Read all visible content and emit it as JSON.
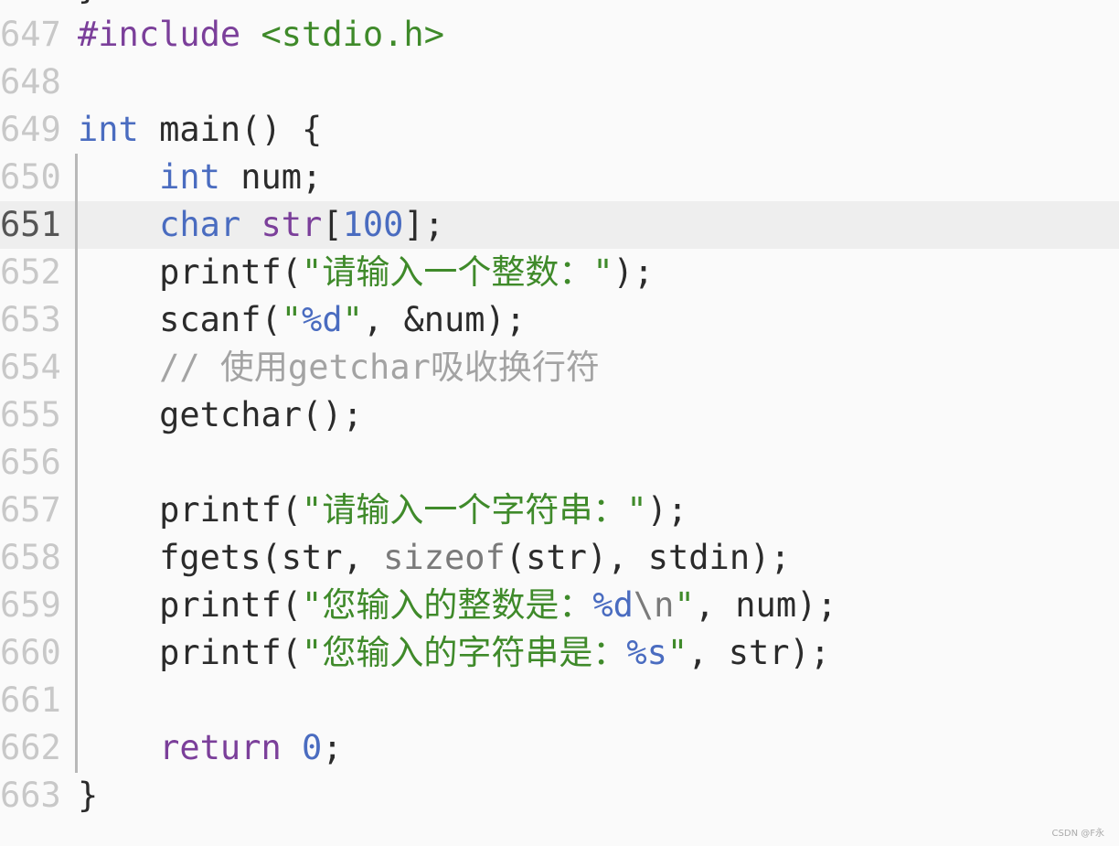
{
  "editor": {
    "active_line": "651",
    "colors": {
      "keyword": "#7b3f9a",
      "type": "#4a6cc0",
      "string": "#3f8a2a",
      "comment": "#a3a3a3",
      "plain": "#2b2b2b",
      "background": "#fafafa",
      "active_line": "#eeeeee"
    },
    "lines": [
      {
        "num": "",
        "tokens": [
          [
            "}",
            "pl"
          ]
        ]
      },
      {
        "num": "647",
        "tokens": [
          [
            "#include",
            "kw"
          ],
          [
            " ",
            "pl"
          ],
          [
            "<stdio.h>",
            "st"
          ]
        ]
      },
      {
        "num": "648",
        "tokens": []
      },
      {
        "num": "649",
        "tokens": [
          [
            "int",
            "ty"
          ],
          [
            " main() {",
            "pl"
          ]
        ]
      },
      {
        "num": "650",
        "tokens": [
          [
            "    ",
            "pl"
          ],
          [
            "int",
            "ty"
          ],
          [
            " num;",
            "pl"
          ]
        ]
      },
      {
        "num": "651",
        "tokens": [
          [
            "    ",
            "pl"
          ],
          [
            "char",
            "ty"
          ],
          [
            " ",
            "pl"
          ],
          [
            "str",
            "kw"
          ],
          [
            "[",
            "pl"
          ],
          [
            "100",
            "ty"
          ],
          [
            "];",
            "pl"
          ]
        ]
      },
      {
        "num": "652",
        "tokens": [
          [
            "    printf(",
            "pl"
          ],
          [
            "\"请输入一个整数：\"",
            "st"
          ],
          [
            ");",
            "pl"
          ]
        ]
      },
      {
        "num": "653",
        "tokens": [
          [
            "    scanf(",
            "pl"
          ],
          [
            "\"",
            "st"
          ],
          [
            "%d",
            "ty"
          ],
          [
            "\"",
            "st"
          ],
          [
            ", &num);",
            "pl"
          ]
        ]
      },
      {
        "num": "654",
        "tokens": [
          [
            "    ",
            "pl"
          ],
          [
            "// 使用getchar吸收换行符",
            "cm"
          ]
        ]
      },
      {
        "num": "655",
        "tokens": [
          [
            "    getchar();",
            "pl"
          ]
        ]
      },
      {
        "num": "656",
        "tokens": []
      },
      {
        "num": "657",
        "tokens": [
          [
            "    printf(",
            "pl"
          ],
          [
            "\"请输入一个字符串：\"",
            "st"
          ],
          [
            ");",
            "pl"
          ]
        ]
      },
      {
        "num": "658",
        "tokens": [
          [
            "    fgets(str, ",
            "pl"
          ],
          [
            "sizeof",
            "gr"
          ],
          [
            "(str), stdin);",
            "pl"
          ]
        ]
      },
      {
        "num": "659",
        "tokens": [
          [
            "    printf(",
            "pl"
          ],
          [
            "\"您输入的整数是：",
            "st"
          ],
          [
            "%d",
            "ty"
          ],
          [
            "\\n",
            "gr"
          ],
          [
            "\"",
            "st"
          ],
          [
            ", num);",
            "pl"
          ]
        ]
      },
      {
        "num": "660",
        "tokens": [
          [
            "    printf(",
            "pl"
          ],
          [
            "\"您输入的字符串是：",
            "st"
          ],
          [
            "%s",
            "ty"
          ],
          [
            "\"",
            "st"
          ],
          [
            ", str);",
            "pl"
          ]
        ]
      },
      {
        "num": "661",
        "tokens": []
      },
      {
        "num": "662",
        "tokens": [
          [
            "    ",
            "pl"
          ],
          [
            "return",
            "kw"
          ],
          [
            " ",
            "pl"
          ],
          [
            "0",
            "ty"
          ],
          [
            ";",
            "pl"
          ]
        ]
      },
      {
        "num": "663",
        "tokens": [
          [
            "}",
            "pl"
          ]
        ]
      }
    ]
  },
  "watermark": "CSDN @F永"
}
